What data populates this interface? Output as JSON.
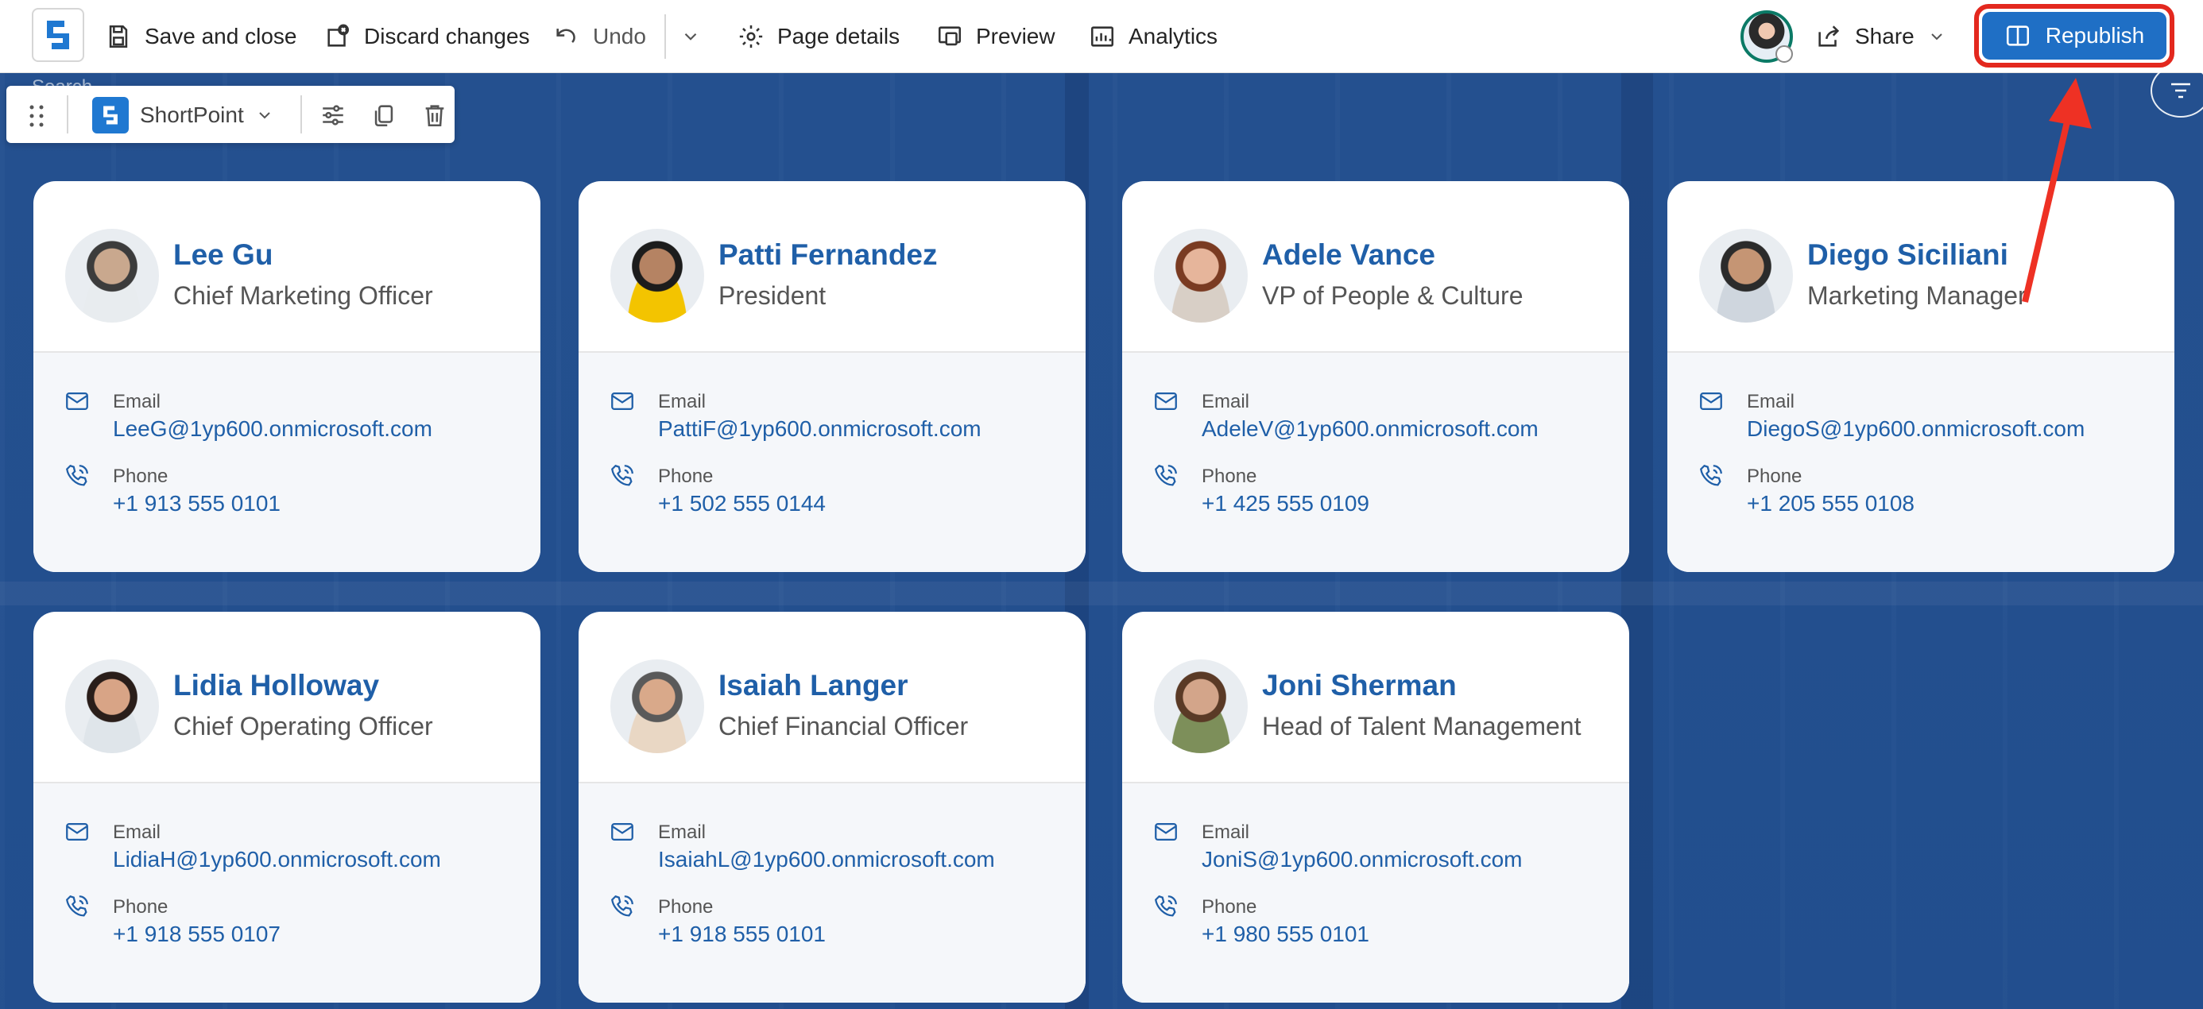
{
  "toolbar": {
    "save_close": "Save and close",
    "discard": "Discard changes",
    "undo": "Undo",
    "page_details": "Page details",
    "preview": "Preview",
    "analytics": "Analytics",
    "share": "Share",
    "republish": "Republish"
  },
  "search_placeholder": "Search",
  "webpart_toolbar": {
    "name": "ShortPoint"
  },
  "labels": {
    "email": "Email",
    "phone": "Phone"
  },
  "colors": {
    "accent": "#1f6fc5",
    "name_blue": "#1f5fa8",
    "highlight_red": "#e3281e"
  },
  "people": [
    {
      "name": "Lee Gu",
      "title": "Chief Marketing Officer",
      "email": "LeeG@1yp600.onmicrosoft.com",
      "phone": "+1 913 555 0101"
    },
    {
      "name": "Patti Fernandez",
      "title": "President",
      "email": "PattiF@1yp600.onmicrosoft.com",
      "phone": "+1 502 555 0144"
    },
    {
      "name": "Adele Vance",
      "title": "VP of People & Culture",
      "email": "AdeleV@1yp600.onmicrosoft.com",
      "phone": "+1 425 555 0109"
    },
    {
      "name": "Diego Siciliani",
      "title": "Marketing Manager",
      "email": "DiegoS@1yp600.onmicrosoft.com",
      "phone": "+1 205 555 0108"
    },
    {
      "name": "Lidia Holloway",
      "title": "Chief Operating Officer",
      "email": "LidiaH@1yp600.onmicrosoft.com",
      "phone": "+1 918 555 0107"
    },
    {
      "name": "Isaiah Langer",
      "title": "Chief Financial Officer",
      "email": "IsaiahL@1yp600.onmicrosoft.com",
      "phone": "+1 918 555 0101"
    },
    {
      "name": "Joni Sherman",
      "title": "Head of Talent Management",
      "email": "JoniS@1yp600.onmicrosoft.com",
      "phone": "+1 980 555 0101"
    }
  ]
}
